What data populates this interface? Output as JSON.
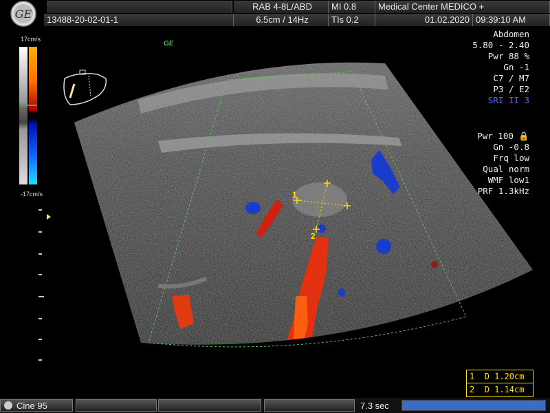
{
  "header": {
    "probe": "RAB 4-8L/ABD",
    "mi": "MI 0.8",
    "institution": "Medical Center MEDICO +",
    "patient_id": "13488-20-02-01-1",
    "depth_freq": "6.5cm / 14Hz",
    "tis": "TIs 0.2",
    "date": "01.02.2020",
    "time": "09:39:10 AM"
  },
  "logo": {
    "text": "GE",
    "icon": "ge-logo-icon"
  },
  "ge_tag": "GE",
  "color_scale": {
    "top": "17cm/s",
    "bottom": "-17cm/s"
  },
  "bmode_params": [
    "Abdomen",
    "5.80 - 2.40",
    "Pwr  88 %",
    "Gn  -1",
    "C7 / M7",
    "P3 / E2"
  ],
  "sri": "SRI II 3",
  "doppler_params": [
    "Pwr 100 🔒",
    "Gn -0.8",
    "Frq low",
    "Qual norm",
    "WMF low1",
    "PRF  1.3kHz"
  ],
  "markers": {
    "m1": "1",
    "m2": "2"
  },
  "measurements": [
    {
      "idx": "1",
      "text": "D 1.20cm"
    },
    {
      "idx": "2",
      "text": "D 1.14cm"
    }
  ],
  "bottom": {
    "cine": "Cine 95",
    "duration": "7.3 sec",
    "progress": 1.0
  },
  "colors": {
    "accent_yellow": "#ffe000",
    "sri_blue": "#4a6cff",
    "progress_blue": "#3a6cc8"
  }
}
